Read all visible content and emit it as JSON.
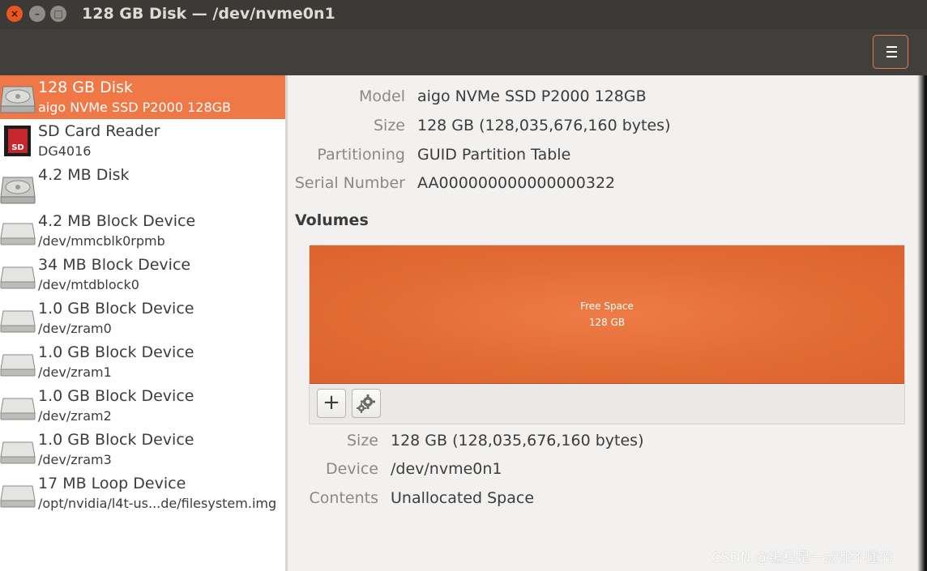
{
  "window": {
    "title": "128 GB Disk — /dev/nvme0n1",
    "close_glyph": "×",
    "minimize_glyph": "–",
    "maximize_glyph": "□"
  },
  "toolbar": {
    "menu_icon": "hamburger-menu-icon"
  },
  "devices": [
    {
      "name": "128 GB Disk",
      "sub": "aigo NVMe SSD P2000 128GB",
      "icon": "hard-disk-icon",
      "selected": true
    },
    {
      "name": "SD Card Reader",
      "sub": "DG4016",
      "icon": "sd-card-icon",
      "selected": false
    },
    {
      "name": "4.2 MB Disk",
      "sub": "",
      "icon": "hard-disk-icon",
      "selected": false
    },
    {
      "name": "4.2 MB Block Device",
      "sub": "/dev/mmcblk0rpmb",
      "icon": "drive-icon",
      "selected": false
    },
    {
      "name": "34 MB Block Device",
      "sub": "/dev/mtdblock0",
      "icon": "drive-icon",
      "selected": false
    },
    {
      "name": "1.0 GB Block Device",
      "sub": "/dev/zram0",
      "icon": "drive-icon",
      "selected": false
    },
    {
      "name": "1.0 GB Block Device",
      "sub": "/dev/zram1",
      "icon": "drive-icon",
      "selected": false
    },
    {
      "name": "1.0 GB Block Device",
      "sub": "/dev/zram2",
      "icon": "drive-icon",
      "selected": false
    },
    {
      "name": "1.0 GB Block Device",
      "sub": "/dev/zram3",
      "icon": "drive-icon",
      "selected": false
    },
    {
      "name": "17 MB Loop Device",
      "sub": "/opt/nvidia/l4t-us...de/filesystem.img",
      "icon": "drive-icon",
      "selected": false
    }
  ],
  "disk_info": {
    "model_label": "Model",
    "model_value": "aigo NVMe SSD P2000 128GB",
    "size_label": "Size",
    "size_value": "128 GB (128,035,676,160 bytes)",
    "partitioning_label": "Partitioning",
    "partitioning_value": "GUID Partition Table",
    "serial_label": "Serial Number",
    "serial_value": "AA000000000000000322"
  },
  "volumes": {
    "title": "Volumes",
    "free_space_label": "Free Space",
    "free_space_size": "128 GB",
    "add_button": "+",
    "settings_icon": "gear-icon"
  },
  "volume_info": {
    "size_label": "Size",
    "size_value": "128 GB (128,035,676,160 bytes)",
    "device_label": "Device",
    "device_value": "/dev/nvme0n1",
    "contents_label": "Contents",
    "contents_value": "Unallocated Space"
  },
  "watermark": "CSDN @编程是一点都不懂的",
  "colors": {
    "accent": "#f07746",
    "titlebar": "#3b3a37",
    "free_space": "#e26a33"
  }
}
